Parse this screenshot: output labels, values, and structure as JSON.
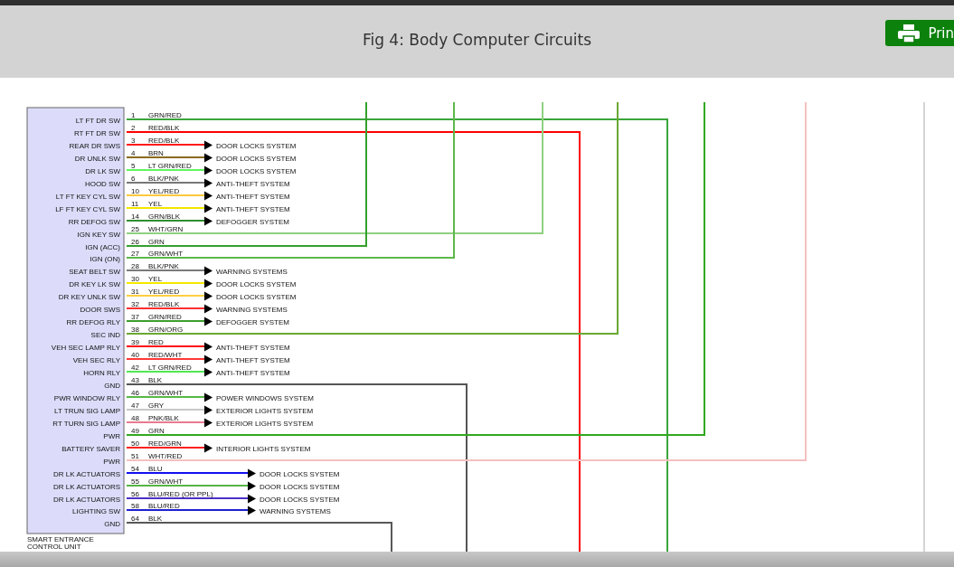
{
  "header": {
    "title": "Fig 4: Body Computer Circuits",
    "print_button": "Prin"
  },
  "module": {
    "name_lines": [
      "SMART ENTRANCE",
      "CONTROL UNIT"
    ]
  },
  "wires": [
    {
      "pin": "LT FT DR SW",
      "number": "1",
      "code": "GRN/RED",
      "color": "#3aa53a",
      "kind": "down"
    },
    {
      "pin": "RT FT DR SW",
      "number": "2",
      "code": "RED/BLK",
      "color": "#ff0000",
      "kind": "down"
    },
    {
      "pin": "REAR DR SWS",
      "number": "3",
      "code": "RED/BLK",
      "color": "#ff1a1a",
      "kind": "near",
      "system": "DOOR LOCKS SYSTEM"
    },
    {
      "pin": "DR UNLK SW",
      "number": "4",
      "code": "BRN",
      "color": "#8b6b1e",
      "kind": "near",
      "system": "DOOR LOCKS SYSTEM"
    },
    {
      "pin": "DR LK SW",
      "number": "5",
      "code": "LT GRN/RED",
      "color": "#5ff55f",
      "kind": "near",
      "system": "DOOR LOCKS SYSTEM"
    },
    {
      "pin": "HOOD SW",
      "number": "6",
      "code": "BLK/PNK",
      "color": "#777777",
      "kind": "near",
      "system": "ANTI-THEFT SYSTEM"
    },
    {
      "pin": "LT FT KEY CYL SW",
      "number": "10",
      "code": "YEL/RED",
      "color": "#ffc83c",
      "kind": "near",
      "system": "ANTI-THEFT SYSTEM"
    },
    {
      "pin": "LF FT KEY CYL SW",
      "number": "11",
      "code": "YEL",
      "color": "#f2e600",
      "kind": "near",
      "system": "ANTI-THEFT SYSTEM"
    },
    {
      "pin": "RR DEFOG SW",
      "number": "14",
      "code": "GRN/BLK",
      "color": "#2f8f2f",
      "kind": "near",
      "system": "DEFOGGER SYSTEM"
    },
    {
      "pin": "IGN KEY SW",
      "number": "25",
      "code": "WHT/GRN",
      "color": "#8fd080",
      "kind": "up"
    },
    {
      "pin": "IGN (ACC)",
      "number": "26",
      "code": "GRN",
      "color": "#33a02c",
      "kind": "up"
    },
    {
      "pin": "IGN (ON)",
      "number": "27",
      "code": "GRN/WHT",
      "color": "#5cb84a",
      "kind": "up"
    },
    {
      "pin": "SEAT BELT SW",
      "number": "28",
      "code": "BLK/PNK",
      "color": "#7a7a7a",
      "kind": "near",
      "system": "WARNING SYSTEMS"
    },
    {
      "pin": "DR KEY LK SW",
      "number": "30",
      "code": "YEL",
      "color": "#f5e800",
      "kind": "near",
      "system": "DOOR LOCKS SYSTEM"
    },
    {
      "pin": "DR KEY UNLK SW",
      "number": "31",
      "code": "YEL/RED",
      "color": "#ffcf40",
      "kind": "near",
      "system": "DOOR LOCKS SYSTEM"
    },
    {
      "pin": "DOOR SWS",
      "number": "32",
      "code": "RED/BLK",
      "color": "#ff3030",
      "kind": "near",
      "system": "WARNING SYSTEMS"
    },
    {
      "pin": "RR DEFOG RLY",
      "number": "37",
      "code": "GRN/RED",
      "color": "#3c9e2e",
      "kind": "near",
      "system": "DEFOGGER SYSTEM"
    },
    {
      "pin": "SEC IND",
      "number": "38",
      "code": "GRN/ORG",
      "color": "#6aa832",
      "kind": "up"
    },
    {
      "pin": "VEH SEC LAMP RLY",
      "number": "39",
      "code": "RED",
      "color": "#ff0808",
      "kind": "near",
      "system": "ANTI-THEFT SYSTEM"
    },
    {
      "pin": "VEH SEC RLY",
      "number": "40",
      "code": "RED/WHT",
      "color": "#ff3838",
      "kind": "near",
      "system": "ANTI-THEFT SYSTEM"
    },
    {
      "pin": "HORN RLY",
      "number": "42",
      "code": "LT GRN/RED",
      "color": "#52e852",
      "kind": "near",
      "system": "ANTI-THEFT SYSTEM"
    },
    {
      "pin": "GND",
      "number": "43",
      "code": "BLK",
      "color": "#555555",
      "kind": "down"
    },
    {
      "pin": "PWR WINDOW RLY",
      "number": "46",
      "code": "GRN/WHT",
      "color": "#58b848",
      "kind": "near",
      "system": "POWER WINDOWS SYSTEM"
    },
    {
      "pin": "LT TRUN SIG LAMP",
      "number": "47",
      "code": "GRY",
      "color": "#c8c8c8",
      "kind": "near",
      "system": "EXTERIOR LIGHTS SYSTEM"
    },
    {
      "pin": "RT TURN SIG LAMP",
      "number": "48",
      "code": "PNK/BLK",
      "color": "#e87a90",
      "kind": "near",
      "system": "EXTERIOR LIGHTS SYSTEM"
    },
    {
      "pin": "PWR",
      "number": "49",
      "code": "GRN",
      "color": "#30a820",
      "kind": "up"
    },
    {
      "pin": "BATTERY SAVER",
      "number": "50",
      "code": "RED/GRN",
      "color": "#ff2020",
      "kind": "near",
      "system": "INTERIOR LIGHTS SYSTEM"
    },
    {
      "pin": "PWR",
      "number": "51",
      "code": "WHT/RED",
      "color": "#f5c0c0",
      "kind": "up"
    },
    {
      "pin": "DR LK ACTUATORS",
      "number": "54",
      "code": "BLU",
      "color": "#1010ee",
      "kind": "far",
      "system": "DOOR LOCKS SYSTEM"
    },
    {
      "pin": "DR LK ACTUATORS",
      "number": "55",
      "code": "GRN/WHT",
      "color": "#56b646",
      "kind": "far",
      "system": "DOOR LOCKS SYSTEM"
    },
    {
      "pin": "DR LK ACTUATORS",
      "number": "56",
      "code": "BLU/RED (OR PPL)",
      "color": "#5030c8",
      "kind": "far",
      "system": "DOOR LOCKS SYSTEM"
    },
    {
      "pin": "LIGHTING SW",
      "number": "58",
      "code": "BLU/RED",
      "color": "#2020d0",
      "kind": "far",
      "system": "WARNING SYSTEMS"
    },
    {
      "pin": "GND",
      "number": "64",
      "code": "BLK",
      "color": "#585858",
      "kind": "down"
    }
  ]
}
